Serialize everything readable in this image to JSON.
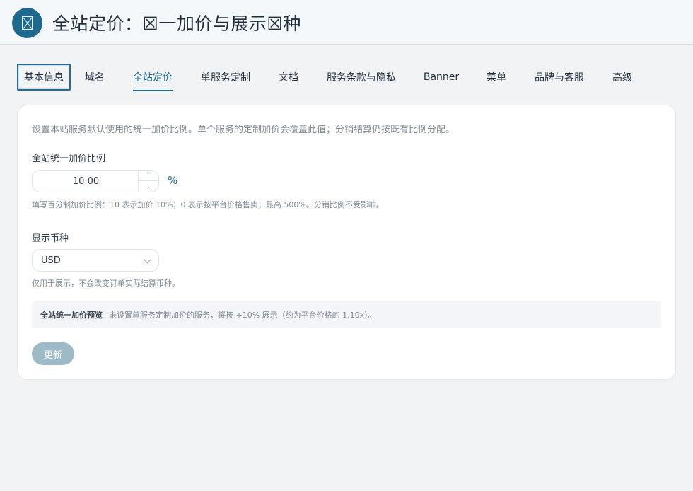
{
  "header": {
    "title": "全站定价：☒一加价与展示☒种",
    "logo_icon": "broken-image-icon"
  },
  "tabs": [
    {
      "label": "基本信息"
    },
    {
      "label": "域名"
    },
    {
      "label": "全站定价"
    },
    {
      "label": "单服务定制"
    },
    {
      "label": "文档"
    },
    {
      "label": "服务条款与隐私"
    },
    {
      "label": "Banner"
    },
    {
      "label": "菜单"
    },
    {
      "label": "品牌与客服"
    },
    {
      "label": "高级"
    }
  ],
  "form": {
    "description": "设置本站服务默认使用的统一加价比例。单个服务的定制加价会覆盖此值；分销结算仍按既有比例分配。",
    "markup_label": "全站统一加价比例",
    "markup_value": "10.00",
    "markup_unit": "%",
    "markup_hint": "填写百分制加价比例：10 表示加价 10%；0 表示按平台价格售卖；最高 500%。分销比例不受影响。",
    "currency_label": "显示币种",
    "currency_value": "USD",
    "currency_hint": "仅用于展示，不会改变订单实际结算币种。",
    "preview_title": "全站统一加价预览",
    "preview_text": "未设置单服务定制加价的服务，将按 +10% 展示（约为平台价格的 1.10x）。",
    "update_label": "更新"
  },
  "colors": {
    "accent": "#1e6a8e",
    "button_disabled": "#9fbac7"
  }
}
